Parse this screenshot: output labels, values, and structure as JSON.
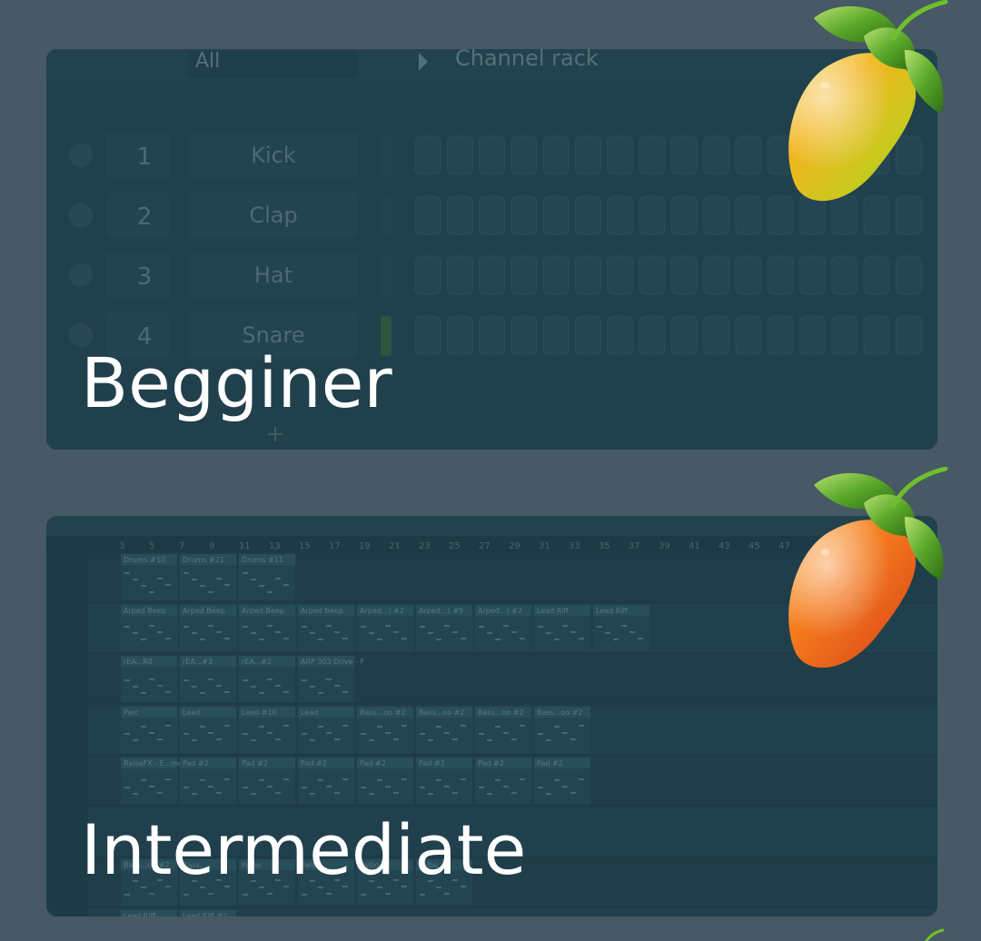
{
  "cards": [
    {
      "id": "beginner",
      "title": "Begginer",
      "background": {
        "kind": "channel-rack-screenshot",
        "filter_label": "All",
        "panel_title": "Channel rack",
        "channels": [
          {
            "number": "1",
            "name": "Kick"
          },
          {
            "number": "2",
            "name": "Clap"
          },
          {
            "number": "3",
            "name": "Hat"
          },
          {
            "number": "4",
            "name": "Snare"
          }
        ],
        "steps_per_row": 16
      },
      "logo": "fl-studio-yellow-fruit-icon"
    },
    {
      "id": "intermediate",
      "title": "Intermediate",
      "background": {
        "kind": "playlist-screenshot",
        "ruler": [
          "3",
          "5",
          "7",
          "9",
          "11",
          "13",
          "15",
          "17",
          "19",
          "21",
          "23",
          "25",
          "27",
          "29",
          "31",
          "33",
          "35",
          "37",
          "39",
          "41",
          "43",
          "45",
          "47"
        ],
        "clips": [
          {
            "row": 0,
            "label": "Drums #10"
          },
          {
            "row": 0,
            "label": "Drums #21"
          },
          {
            "row": 0,
            "label": "Drums #11"
          },
          {
            "row": 1,
            "label": "Arped Beep"
          },
          {
            "row": 1,
            "label": "Arped Beep"
          },
          {
            "row": 1,
            "label": "Arped Beep"
          },
          {
            "row": 1,
            "label": "Arped Beep"
          },
          {
            "row": 1,
            "label": "Arped...) #2"
          },
          {
            "row": 1,
            "label": "Arped...) #5"
          },
          {
            "row": 1,
            "label": "Arped...) #2"
          },
          {
            "row": 1,
            "label": "Lead Riff"
          },
          {
            "row": 1,
            "label": "Lead Riff"
          },
          {
            "row": 2,
            "label": "rEA...R0"
          },
          {
            "row": 2,
            "label": "rEA...#3"
          },
          {
            "row": 2,
            "label": "rEA...#2"
          },
          {
            "row": 2,
            "label": "ARP 303 Drive - F"
          },
          {
            "row": 3,
            "label": "Perc"
          },
          {
            "row": 3,
            "label": "Lead"
          },
          {
            "row": 3,
            "label": "Lead #10"
          },
          {
            "row": 3,
            "label": "Lead"
          },
          {
            "row": 3,
            "label": "Bass...oo #2"
          },
          {
            "row": 3,
            "label": "Bass...oo #2"
          },
          {
            "row": 3,
            "label": "Bass...oo #2"
          },
          {
            "row": 3,
            "label": "Bass...oo #2"
          },
          {
            "row": 4,
            "label": "RaiseFX - E...me envelope"
          },
          {
            "row": 4,
            "label": "Pad #2"
          },
          {
            "row": 4,
            "label": "Pad #2"
          },
          {
            "row": 4,
            "label": "Pad #2"
          },
          {
            "row": 4,
            "label": "Pad #2"
          },
          {
            "row": 4,
            "label": "Pad #2"
          },
          {
            "row": 4,
            "label": "Pad #2"
          },
          {
            "row": 4,
            "label": "Pad #2"
          },
          {
            "row": 6,
            "label": "Bass...oo #2"
          },
          {
            "row": 6,
            "label": "Bass..."
          },
          {
            "row": 6,
            "label": "Palbo"
          },
          {
            "row": 6,
            "label": "Palbo"
          },
          {
            "row": 6,
            "label": "Palbo"
          },
          {
            "row": 6,
            "label": "Palbo"
          },
          {
            "row": 7,
            "label": "Lead Riff"
          },
          {
            "row": 7,
            "label": "Lead Riff #2"
          }
        ]
      },
      "logo": "fl-studio-orange-fruit-icon"
    }
  ],
  "colors": {
    "page_background": "#465964",
    "card_background": "#1f3d4a",
    "title_text": "#ffffff",
    "fruit_yellow": "#e8c21a",
    "fruit_orange": "#ee6a16",
    "leaf_green": "#4e9a2a"
  }
}
